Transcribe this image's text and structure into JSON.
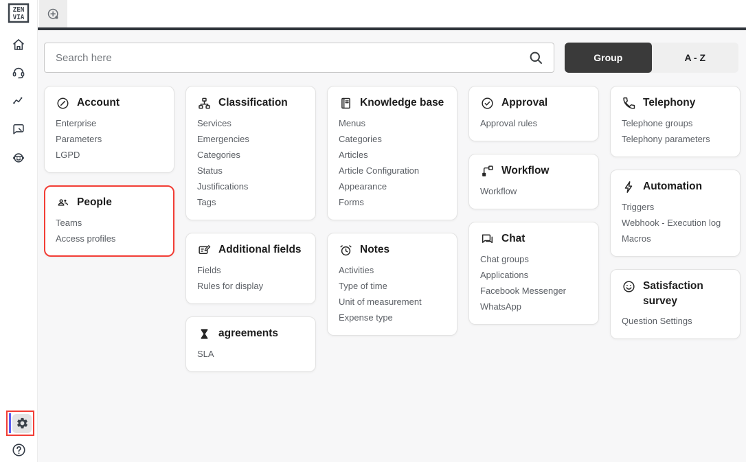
{
  "sidebar": {
    "logo_icon": "zenvia-logo",
    "nav_icons": [
      "home-icon",
      "headset-icon",
      "activity-icon",
      "chat-icon",
      "bot-icon"
    ],
    "settings_icon": "gear-icon",
    "help_icon": "help-icon",
    "active_indicator_color": "#5d5fef"
  },
  "tabbar": {
    "new_tab_icon": "plus-circle-icon"
  },
  "toolbar": {
    "search_placeholder": "Search here",
    "search_icon": "magnifier-icon",
    "group_label": "Group",
    "az_label": "A - Z",
    "selected_view": "Group"
  },
  "annotations": {
    "highlight_color": "#f23d35",
    "highlighted_card": "People",
    "highlighted_sidebar_item": "settings"
  },
  "cards": {
    "columns": [
      [
        {
          "id": "account",
          "icon": "account",
          "title": "Account",
          "items": [
            "Enterprise",
            "Parameters",
            "LGPD"
          ]
        },
        {
          "id": "people",
          "icon": "people",
          "title": "People",
          "highlighted": true,
          "items": [
            "Teams",
            "Access profiles"
          ]
        }
      ],
      [
        {
          "id": "classification",
          "icon": "classification",
          "title": "Classification",
          "items": [
            "Services",
            "Emergencies",
            "Categories",
            "Status",
            "Justifications",
            "Tags"
          ]
        },
        {
          "id": "additional-fields",
          "icon": "additional-fields",
          "title": "Additional fields",
          "items": [
            "Fields",
            "Rules for display"
          ]
        },
        {
          "id": "agreements",
          "icon": "hourglass",
          "title": "agreements",
          "items": [
            "SLA"
          ]
        }
      ],
      [
        {
          "id": "knowledge-base",
          "icon": "book",
          "title": "Knowledge base",
          "items": [
            "Menus",
            "Categories",
            "Articles",
            "Article Configuration",
            "Appearance",
            "Forms"
          ]
        },
        {
          "id": "notes",
          "icon": "alarm-clock",
          "title": "Notes",
          "items": [
            "Activities",
            "Type of time",
            "Unit of measurement",
            "Expense type"
          ]
        }
      ],
      [
        {
          "id": "approval",
          "icon": "check-circle",
          "title": "Approval",
          "items": [
            "Approval rules"
          ]
        },
        {
          "id": "workflow",
          "icon": "workflow",
          "title": "Workflow",
          "items": [
            "Workflow"
          ]
        },
        {
          "id": "chat",
          "icon": "chat-double",
          "title": "Chat",
          "items": [
            "Chat groups",
            "Applications",
            "Facebook Messenger",
            "WhatsApp"
          ]
        }
      ],
      [
        {
          "id": "telephony",
          "icon": "phone",
          "title": "Telephony",
          "items": [
            "Telephone groups",
            "Telephony parameters"
          ]
        },
        {
          "id": "automation",
          "icon": "lightning",
          "title": "Automation",
          "items": [
            "Triggers",
            "Webhook - Execution log",
            "Macros"
          ]
        },
        {
          "id": "satisfaction-survey",
          "icon": "smiley",
          "title": "Satisfaction survey",
          "items": [
            "Question Settings"
          ]
        }
      ]
    ]
  },
  "colors": {
    "tab_underline": "#2f343a",
    "content_background": "#f7f7f8",
    "selected_segment": "#3a3a3a",
    "card_title": "#1d1d1d",
    "card_item": "#5c6066"
  }
}
